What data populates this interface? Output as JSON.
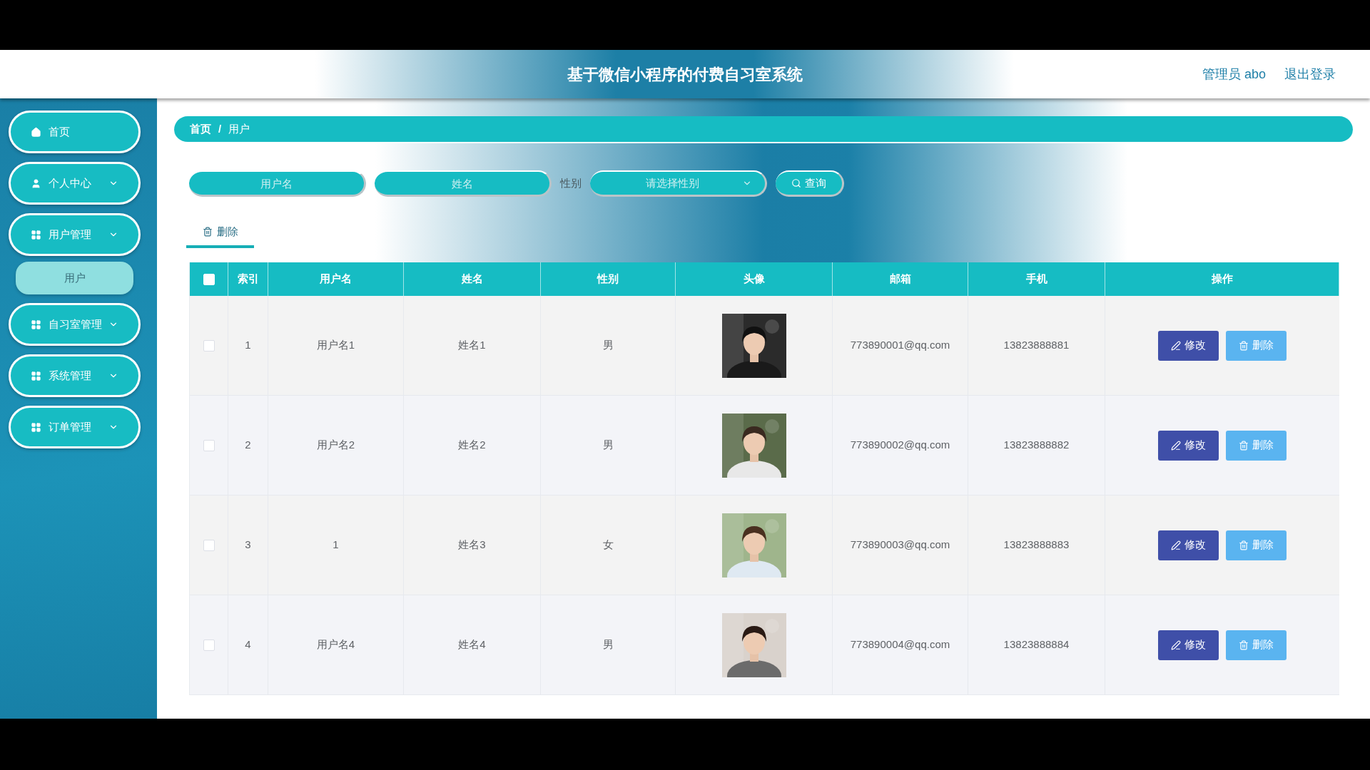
{
  "header": {
    "title": "基于微信小程序的付费自习室系统",
    "user": "管理员 abo",
    "logout": "退出登录"
  },
  "sidebar": {
    "items": [
      {
        "label": "首页",
        "kind": "home"
      },
      {
        "label": "个人中心",
        "kind": "profile"
      },
      {
        "label": "用户管理",
        "kind": "menu",
        "children": [
          {
            "label": "用户"
          }
        ]
      },
      {
        "label": "自习室管理",
        "kind": "menu"
      },
      {
        "label": "系统管理",
        "kind": "menu"
      },
      {
        "label": "订单管理",
        "kind": "menu"
      }
    ]
  },
  "breadcrumb": {
    "items": [
      "首页",
      "用户"
    ],
    "separator": "/"
  },
  "filters": {
    "username": {
      "placeholder": "用户名"
    },
    "name": {
      "placeholder": "姓名"
    },
    "gender_label": "性别",
    "gender": {
      "placeholder": "请选择性别"
    },
    "search": "查询"
  },
  "toolbar": {
    "delete": "删除"
  },
  "table": {
    "columns": [
      "索引",
      "用户名",
      "姓名",
      "性别",
      "头像",
      "邮箱",
      "手机",
      "操作"
    ],
    "select_all": false,
    "rows": [
      {
        "checked": false,
        "index": "1",
        "username": "用户名1",
        "name": "姓名1",
        "gender": "男",
        "email": "773890001@qq.com",
        "phone": "13823888881",
        "actions": [
          "修改",
          "删除"
        ]
      },
      {
        "checked": false,
        "index": "2",
        "username": "用户名2",
        "name": "姓名2",
        "gender": "男",
        "email": "773890002@qq.com",
        "phone": "13823888882",
        "actions": [
          "修改",
          "删除"
        ]
      },
      {
        "checked": false,
        "index": "3",
        "username": "1",
        "name": "姓名3",
        "gender": "女",
        "email": "773890003@qq.com",
        "phone": "13823888883",
        "actions": [
          "修改",
          "删除"
        ]
      },
      {
        "checked": false,
        "index": "4",
        "username": "用户名4",
        "name": "姓名4",
        "gender": "男",
        "email": "773890004@qq.com",
        "phone": "13823888884",
        "actions": [
          "修改",
          "删除"
        ]
      }
    ]
  }
}
